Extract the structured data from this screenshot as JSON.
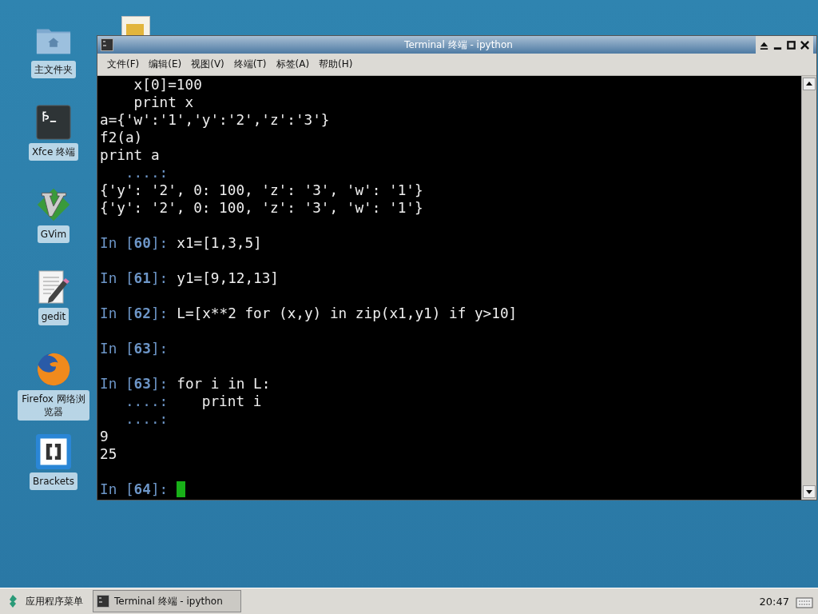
{
  "desktop_icons": [
    {
      "kind": "folder",
      "label": "主文件夹"
    },
    {
      "kind": "terminal",
      "label": "Xfce 终端"
    },
    {
      "kind": "vim",
      "label": "GVim"
    },
    {
      "kind": "editor",
      "label": "gedit"
    },
    {
      "kind": "browser",
      "label": "Firefox 网络浏览器"
    },
    {
      "kind": "brackets",
      "label": "Brackets"
    }
  ],
  "window": {
    "title": "Terminal 终端 - ipython",
    "menu": [
      "文件(F)",
      "编辑(E)",
      "视图(V)",
      "终端(T)",
      "标签(A)",
      "帮助(H)"
    ],
    "lines": [
      {
        "kind": "text",
        "text": "    x[0]=100"
      },
      {
        "kind": "text",
        "text": "    print x"
      },
      {
        "kind": "text",
        "text": "a={'w':'1','y':'2','z':'3'}"
      },
      {
        "kind": "text",
        "text": "f2(a)"
      },
      {
        "kind": "text",
        "text": "print a"
      },
      {
        "kind": "continuation",
        "prompt": "   ....:"
      },
      {
        "kind": "text",
        "text": "{'y': '2', 0: 100, 'z': '3', 'w': '1'}"
      },
      {
        "kind": "text",
        "text": "{'y': '2', 0: 100, 'z': '3', 'w': '1'}"
      },
      {
        "kind": "blank"
      },
      {
        "kind": "prompt",
        "prompt": "In [**60**]:",
        "text": "x1=[1,3,5]",
        "cursor": false
      },
      {
        "kind": "blank"
      },
      {
        "kind": "prompt",
        "prompt": "In [**61**]:",
        "text": "y1=[9,12,13]",
        "cursor": false
      },
      {
        "kind": "blank"
      },
      {
        "kind": "prompt",
        "prompt": "In [**62**]:",
        "text": "L=[x**2 for (x,y) in zip(x1,y1) if y>10]",
        "cursor": false
      },
      {
        "kind": "blank"
      },
      {
        "kind": "prompt",
        "prompt": "In [**63**]:",
        "cursor": false
      },
      {
        "kind": "blank"
      },
      {
        "kind": "prompt",
        "prompt": "In [**63**]:",
        "text": "for i in L:",
        "cursor": false
      },
      {
        "kind": "continuation",
        "prompt": "   ....:",
        "text": "    print i"
      },
      {
        "kind": "continuation",
        "prompt": "   ....:"
      },
      {
        "kind": "text",
        "text": "9"
      },
      {
        "kind": "text",
        "text": "25"
      },
      {
        "kind": "blank"
      },
      {
        "kind": "prompt",
        "prompt": "In [**64**]:",
        "cursor": true
      }
    ]
  },
  "taskbar": {
    "menu_label": "应用程序菜单",
    "task": "Terminal 终端 - ipython",
    "clock": "20:47"
  }
}
